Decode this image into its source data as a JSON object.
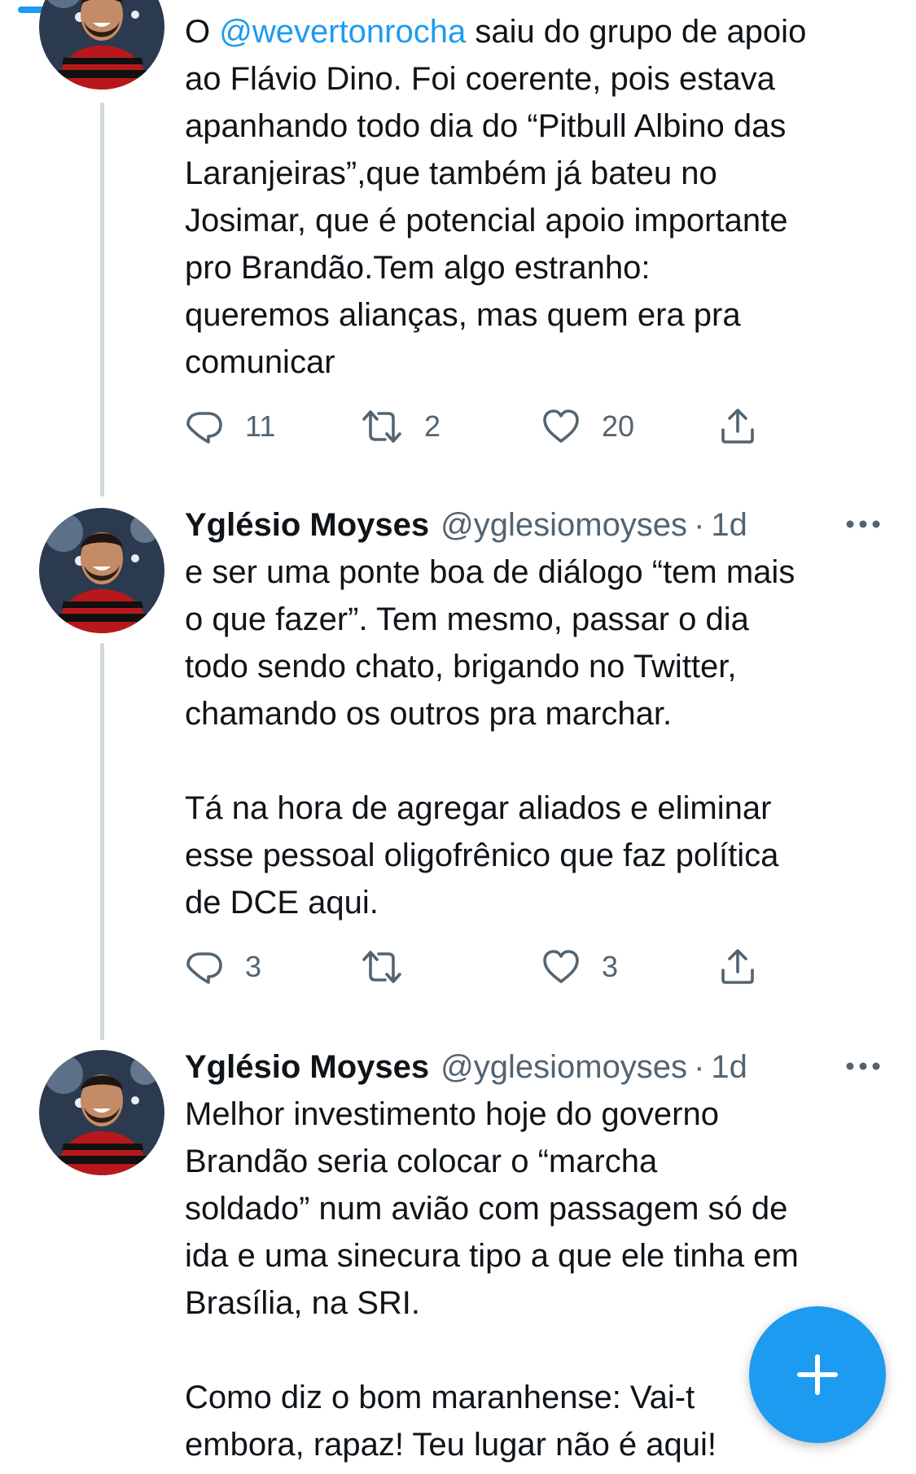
{
  "tweets": [
    {
      "text_prefix": "O ",
      "mention": "@wevertonrocha",
      "text_rest": " saiu do grupo de apoio\nao Flávio Dino. Foi coerente, pois estava\napanhando todo dia do “Pitbull Albino das\nLaranjeiras”,que também já bateu no\nJosimar, que é potencial apoio importante\npro Brandão.Tem algo estranho:\nqueremos alianças, mas quem era pra\ncomunicar",
      "reply_count": "11",
      "retweet_count": "2",
      "like_count": "20"
    },
    {
      "name": "Yglésio Moyses",
      "handle": "@yglesiomoyses",
      "separator": "·",
      "time": "1d",
      "text": "e ser uma ponte boa de diálogo “tem mais\no que fazer”. Tem mesmo, passar o dia\ntodo sendo chato, brigando no Twitter,\nchamando os outros pra marchar.\n\nTá na hora de agregar aliados e eliminar\nesse pessoal oligofrênico que faz política\nde DCE aqui.",
      "reply_count": "3",
      "retweet_count": "",
      "like_count": "3"
    },
    {
      "name": "Yglésio Moyses",
      "handle": "@yglesiomoyses",
      "separator": "·",
      "time": "1d",
      "text": "Melhor investimento hoje do governo\nBrandão seria colocar o “marcha\nsoldado” num avião com passagem só de\nida e uma sinecura tipo a que ele tinha em\nBrasília, na SRI.\n\nComo diz o bom maranhense: Vai-t\nembora, rapaz! Teu lugar não é aqui!"
    }
  ],
  "icons": {
    "reply": "reply-icon",
    "retweet": "retweet-icon",
    "like": "heart-icon",
    "share": "share-icon",
    "more": "more-icon",
    "compose": "plus-icon"
  },
  "colors": {
    "accent": "#1d9bf0",
    "text": "#0f1419",
    "secondary": "#536471",
    "thread_line": "#cfd9de"
  }
}
